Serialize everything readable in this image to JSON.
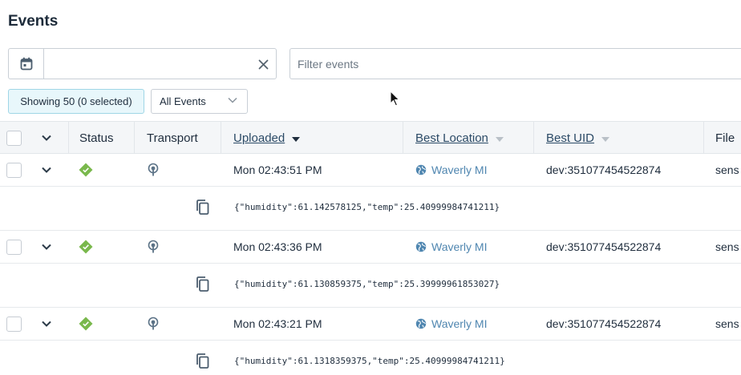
{
  "page": {
    "title": "Events"
  },
  "toolbar": {
    "date_value": "",
    "filter_placeholder": "Filter events",
    "showing_label": "Showing 50 (0 selected)",
    "events_select_value": "All Events"
  },
  "table": {
    "columns": {
      "status": "Status",
      "transport": "Transport",
      "uploaded": "Uploaded",
      "best_location": "Best Location",
      "best_uid": "Best UID",
      "file": "File"
    },
    "rows": [
      {
        "uploaded": "Mon 02:43:51 PM",
        "location": "Waverly MI",
        "uid": "dev:351077454522874",
        "file": "sens",
        "payload": "{\"humidity\":61.142578125,\"temp\":25.40999984741211}"
      },
      {
        "uploaded": "Mon 02:43:36 PM",
        "location": "Waverly MI",
        "uid": "dev:351077454522874",
        "file": "sens",
        "payload": "{\"humidity\":61.130859375,\"temp\":25.39999961853027}"
      },
      {
        "uploaded": "Mon 02:43:21 PM",
        "location": "Waverly MI",
        "uid": "dev:351077454522874",
        "file": "sens",
        "payload": "{\"humidity\":61.1318359375,\"temp\":25.40999984741211}"
      }
    ]
  },
  "colors": {
    "status_ok": "#79b84c",
    "link": "#4f86b0",
    "header_bg": "#f4f6f8",
    "showing_bg": "#e8f7fb"
  },
  "icons": [
    "calendar-icon",
    "close-icon",
    "chevron-down-icon",
    "status-ok-icon",
    "cellular-icon",
    "globe-icon",
    "copy-icon",
    "sort-desc-icon",
    "cursor-icon"
  ]
}
